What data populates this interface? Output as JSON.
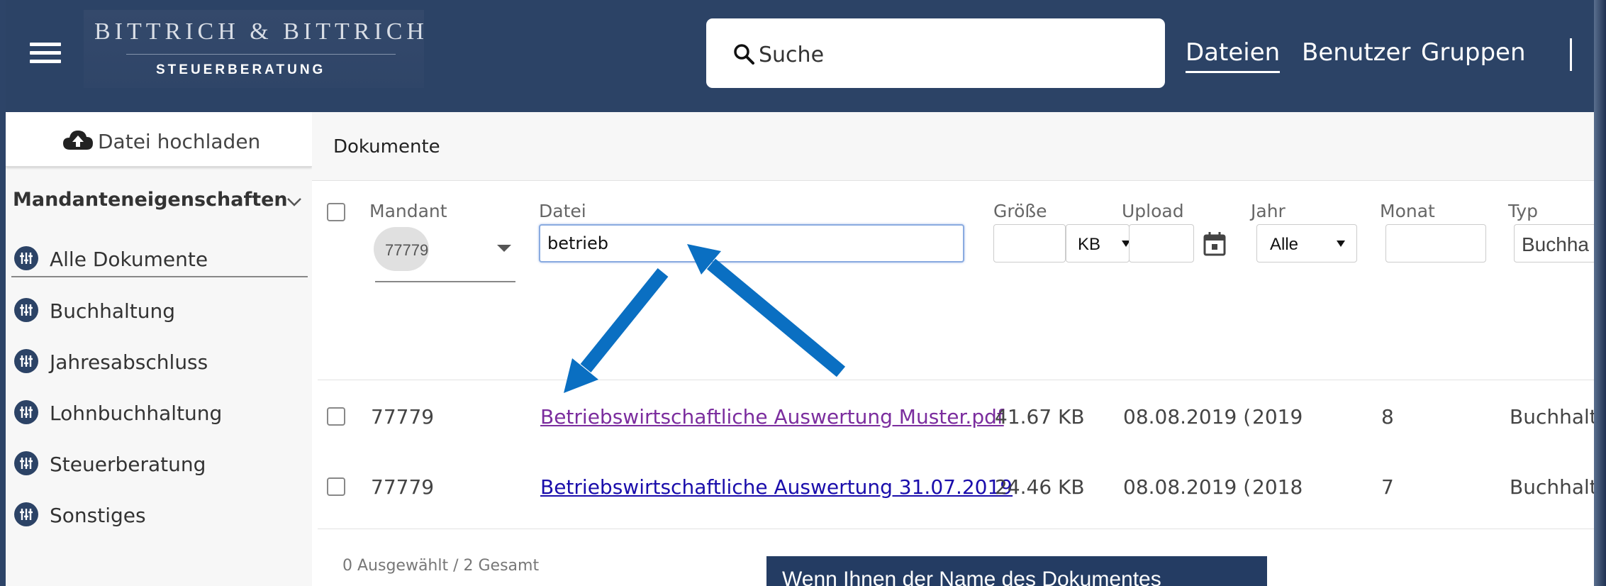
{
  "header": {
    "logo_line1": "BITTRICH & BITTRICH",
    "logo_line2": "STEUERBERATUNG",
    "search_placeholder": "Suche",
    "nav": [
      "Dateien",
      "Benutzer",
      "Gruppen"
    ],
    "active_nav": "Dateien"
  },
  "sidebar": {
    "upload_label": "Datei hochladen",
    "section_title": "Mandanteneigenschaften",
    "items": [
      {
        "label": "Alle Dokumente",
        "selected": true
      },
      {
        "label": "Buchhaltung"
      },
      {
        "label": "Jahresabschluss"
      },
      {
        "label": "Lohnbuchhaltung"
      },
      {
        "label": "Steuerberatung"
      },
      {
        "label": "Sonstiges"
      }
    ]
  },
  "main": {
    "title": "Dokumente",
    "columns": [
      "Mandant",
      "Datei",
      "Größe",
      "Upload",
      "Jahr",
      "Monat",
      "Typ"
    ],
    "filters": {
      "mandant_chip": "77779",
      "datei_value": "betrieb",
      "size_unit": "KB",
      "jahr": "Alle",
      "typ": "Buchha"
    },
    "rows": [
      {
        "mandant": "77779",
        "file": "Betriebswirtschaftliche Auswertung Muster.pdf",
        "size": "41.67 KB",
        "upload": "08.08.2019 (",
        "year": "2019",
        "month": "8",
        "type": "Buchhalt",
        "visited": true
      },
      {
        "mandant": "77779",
        "file": "Betriebswirtschaftliche Auswertung 31.07.2019",
        "size": "24.46 KB",
        "upload": "08.08.2019 (",
        "year": "2018",
        "month": "7",
        "type": "Buchhalt",
        "visited": false
      }
    ],
    "footer_count": "0 Ausgewählt / 2 Gesamt"
  },
  "tooltip_text": "Wenn Ihnen der Name des Dokumentes",
  "colors": {
    "header_bg": "#2c4366",
    "link_visited": "#7b2d9e",
    "link": "#1a0dab",
    "arrow": "#0a6fc2"
  }
}
